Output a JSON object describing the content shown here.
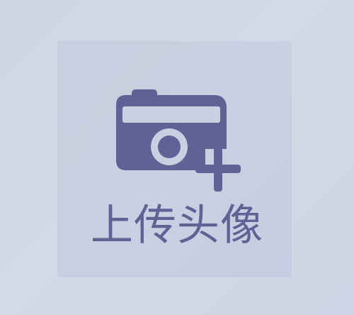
{
  "upload_avatar": {
    "label": "上传头像",
    "icon": "camera-add-icon",
    "icon_color": "#5f6294",
    "tile_color": "#c8cfe1",
    "background_color": "#d0d8e4"
  }
}
